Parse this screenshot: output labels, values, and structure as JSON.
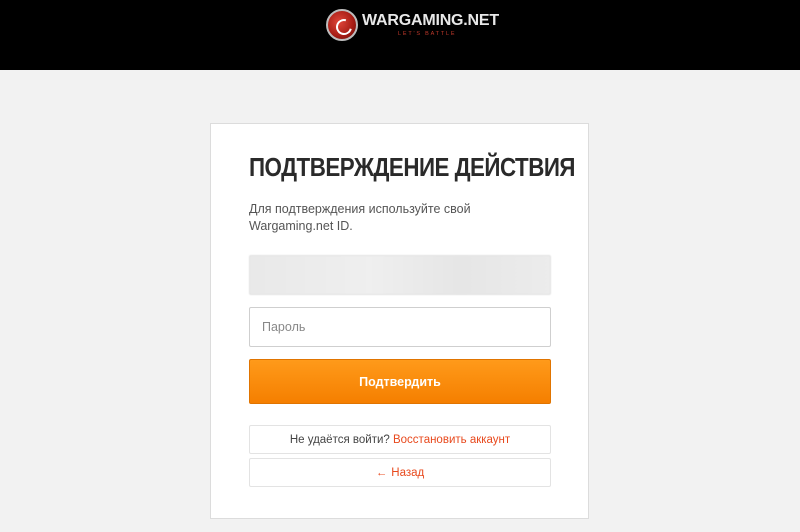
{
  "header": {
    "logo_name": "WARGAMING.NET",
    "logo_tagline": "LET'S BATTLE",
    "logo_icon": "wargaming-emblem-icon"
  },
  "card": {
    "title": "ПОДТВЕРЖДЕНИЕ ДЕЙСТВИЯ",
    "description": "Для подтверждения используйте свой Wargaming.net ID.",
    "password_placeholder": "Пароль",
    "submit_label": "Подтвердить",
    "help_text": "Не удаётся войти? ",
    "restore_link": "Восстановить аккаунт",
    "back_arrow": "←",
    "back_link": "Назад"
  },
  "colors": {
    "accent": "#f58a0b",
    "link": "#e8491d",
    "header_bg": "#000000",
    "page_bg": "#f2f2f2"
  }
}
